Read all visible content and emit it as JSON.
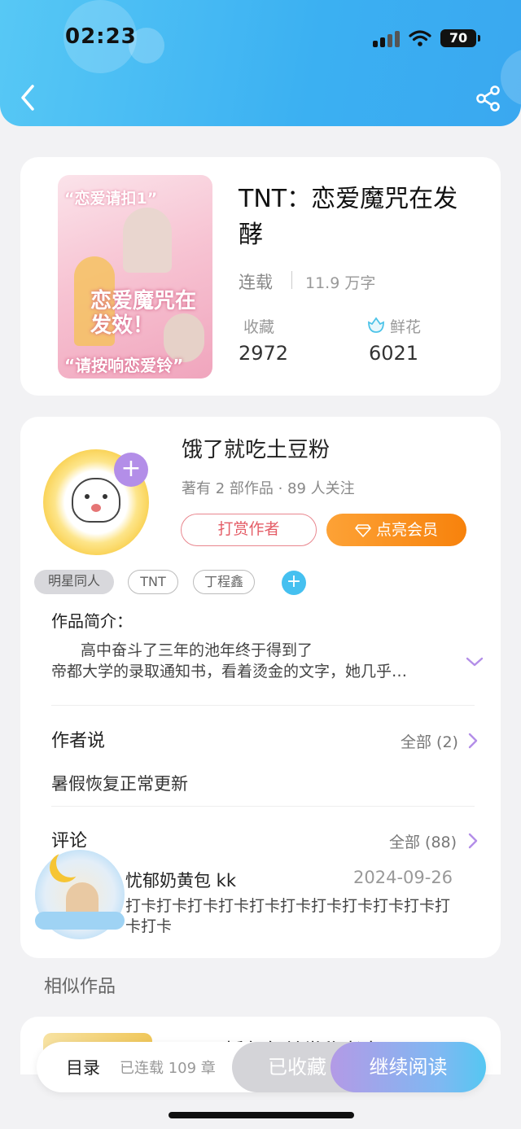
{
  "status_bar": {
    "time": "02:23",
    "battery": "70"
  },
  "book": {
    "title": "TNT：恋爱魔咒在发酵",
    "status": "连载",
    "word_count": "11.9 万字",
    "favorites_label": "收藏",
    "favorites_value": "2972",
    "flowers_label": "鲜花",
    "flowers_value": "6021",
    "cover_text_top": "“恋爱请扣1”",
    "cover_text_main": "恋爱魔咒在发效！",
    "cover_text_bottom": "“请按响恋爱铃”"
  },
  "author": {
    "name": "饿了就吃土豆粉",
    "meta": "著有 2 部作品 · 89 人关注",
    "tip_label": "打赏作者",
    "vip_label": "点亮会员",
    "follow_symbol": "+"
  },
  "tags": [
    "明星同人",
    "TNT",
    "丁程鑫"
  ],
  "tag_add_symbol": "+",
  "intro": {
    "title": "作品简介：",
    "line1": "高中奋斗了三年的池年终于得到了",
    "line2": "帝都大学的录取通知书，看着烫金的文字，她几乎…"
  },
  "author_says": {
    "title": "作者说",
    "more_label": "全部 (2)",
    "text": "暑假恢复正常更新"
  },
  "comments": {
    "title": "评论",
    "more_label": "全部 (88)",
    "items": [
      {
        "user": "忧郁奶黄包 kk",
        "date": "2024-09-26",
        "text": "打卡打卡打卡打卡打卡打卡打卡打卡打卡打卡打卡打卡"
      }
    ]
  },
  "similar": {
    "title": "相似作品",
    "first_title": "TNT：插包包单世秘老卡"
  },
  "bottom_bar": {
    "catalog_label": "目录",
    "chapters_label": "已连载 109 章",
    "collected_label": "已收藏",
    "continue_label": "继续阅读"
  },
  "colors": {
    "header_blue": "#3bb0f2",
    "vip_orange": "#f7820c",
    "tip_red": "#e45c66",
    "purple_accent": "#b38ee8",
    "tag_add_blue": "#45c0f0"
  },
  "icons": [
    "back-arrow-icon",
    "share-icon",
    "signal-icon",
    "wifi-icon",
    "battery-icon",
    "flower-icon",
    "diamond-icon",
    "chevron-down-icon",
    "chevron-right-icon",
    "plus-icon"
  ]
}
